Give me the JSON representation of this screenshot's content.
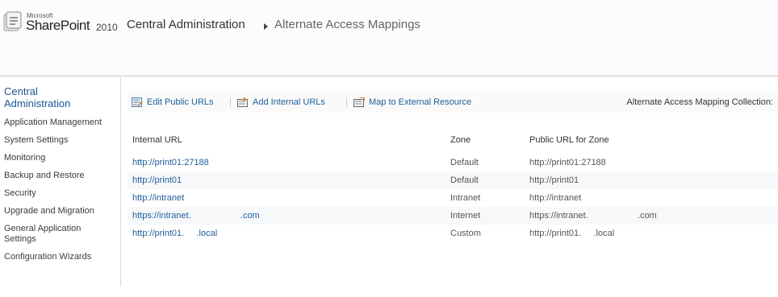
{
  "header": {
    "logo_ms": "Microsoft",
    "logo_product": "SharePoint",
    "logo_year": "2010",
    "breadcrumb_root": "Central Administration",
    "breadcrumb_current": "Alternate Access Mappings"
  },
  "nav": {
    "heading": "Central Administration",
    "items": [
      "Application Management",
      "System Settings",
      "Monitoring",
      "Backup and Restore",
      "Security",
      "Upgrade and Migration",
      "General Application Settings",
      "Configuration Wizards"
    ]
  },
  "toolbar": {
    "edit_public_urls": "Edit Public URLs",
    "add_internal_urls": "Add Internal URLs",
    "map_external": "Map to External Resource",
    "collection_label": "Alternate Access Mapping Collection:"
  },
  "table": {
    "headers": [
      "Internal URL",
      "Zone",
      "Public URL for Zone"
    ],
    "rows": [
      {
        "internal": "http://print01:27188",
        "zone": "Default",
        "public": "http://print01:27188"
      },
      {
        "internal": "http://print01",
        "zone": "Default",
        "public": "http://print01"
      },
      {
        "internal": "http://intranet",
        "zone": "Intranet",
        "public": "http://intranet"
      },
      {
        "internal": "https://intranet.                    .com",
        "zone": "Internet",
        "public": "https://intranet.                    .com"
      },
      {
        "internal": "http://print01.     .local",
        "zone": "Custom",
        "public": "http://print01.     .local"
      }
    ]
  },
  "colors": {
    "link": "#1e5e9b",
    "nav_heading": "#1e5596",
    "alt_row": "#f6f8fa"
  }
}
